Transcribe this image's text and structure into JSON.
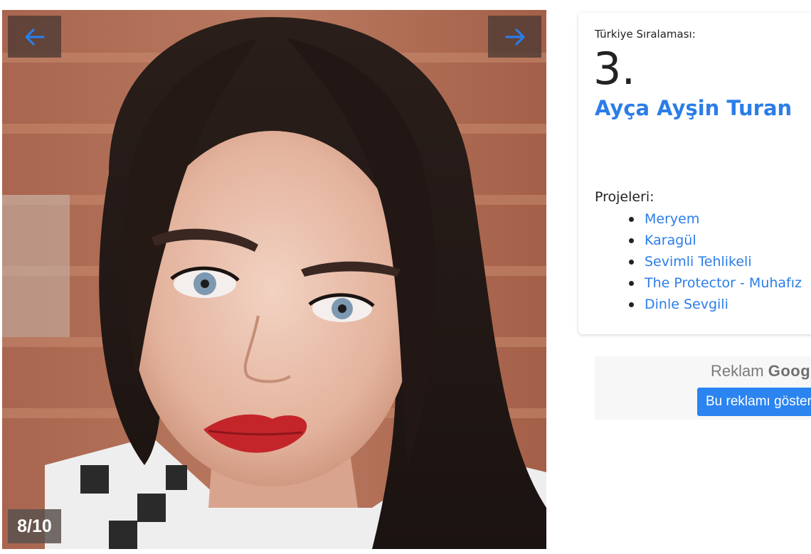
{
  "slider": {
    "prev_icon": "arrow-left-icon",
    "next_icon": "arrow-right-icon",
    "counter": "8/10",
    "arrow_color": "#2b7de9"
  },
  "profile": {
    "rank_label": "Türkiye Sıralaması:",
    "rank_value": "3.",
    "name": "Ayça Ayşin Turan",
    "projects_label": "Projeleri:",
    "projects": [
      "Meryem",
      "Karagül",
      "Sevimli Tehlikeli",
      "The Protector - Muhafız",
      "Dinle Sevgili"
    ],
    "link_color": "#2b7de9"
  },
  "ad": {
    "label": "Reklam",
    "brand": "Google",
    "button": "Bu reklamı gösterme"
  }
}
